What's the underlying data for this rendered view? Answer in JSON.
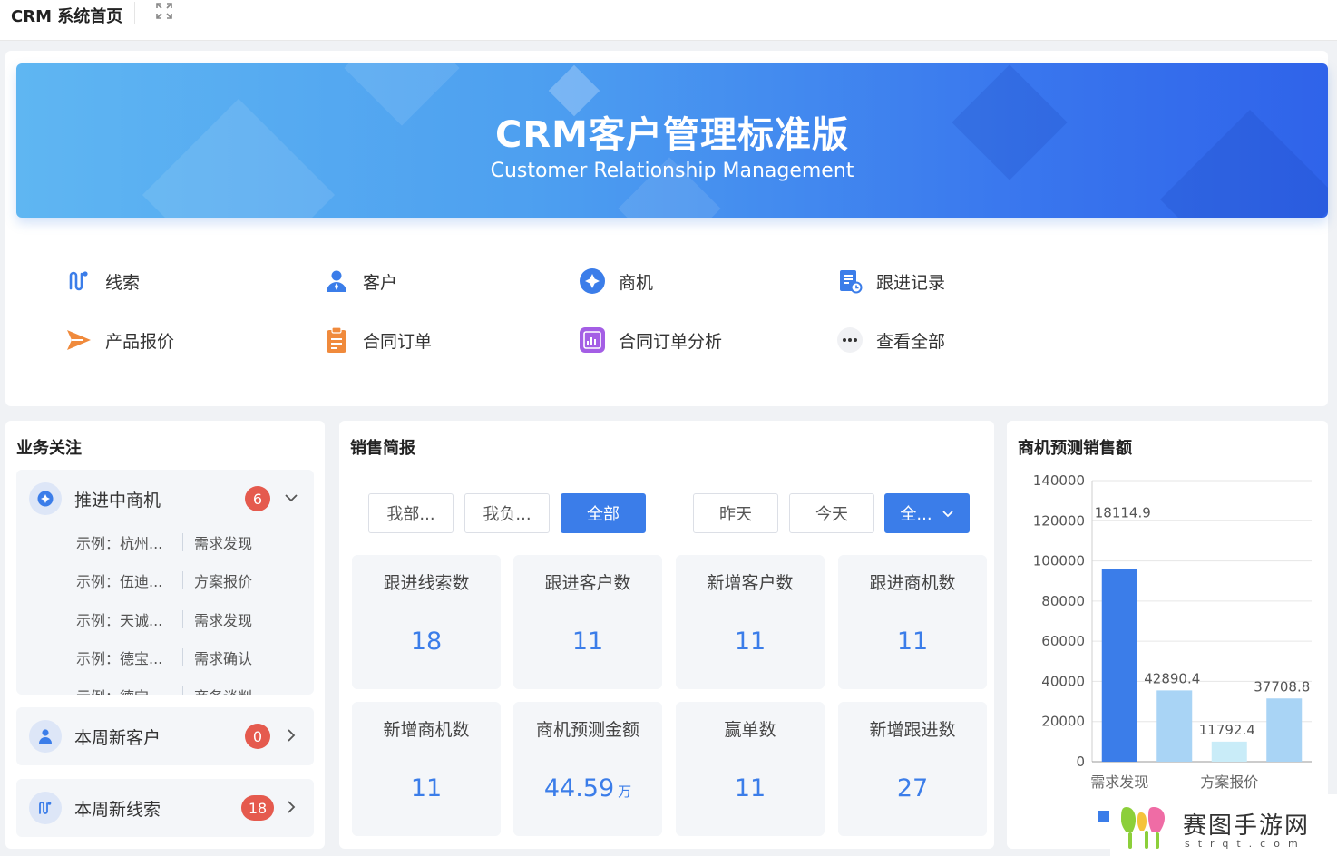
{
  "topbar": {
    "title": "CRM 系统首页"
  },
  "banner": {
    "title": "CRM客户管理标准版",
    "subtitle": "Customer Relationship Management"
  },
  "quick_links": [
    {
      "label": "线索",
      "icon": "leads-icon",
      "color": "#3b7de9"
    },
    {
      "label": "客户",
      "icon": "customer-icon",
      "color": "#3b7de9"
    },
    {
      "label": "商机",
      "icon": "opportunity-icon",
      "color": "#3b7de9"
    },
    {
      "label": "跟进记录",
      "icon": "followup-record-icon",
      "color": "#3b7de9"
    },
    {
      "label": "产品报价",
      "icon": "quote-arrow-icon",
      "color": "#f08a3c"
    },
    {
      "label": "合同订单",
      "icon": "contract-icon",
      "color": "#f08a3c"
    },
    {
      "label": "合同订单分析",
      "icon": "analysis-chart-icon",
      "color": "#a45ee5"
    },
    {
      "label": "查看全部",
      "icon": "more-dots-icon",
      "color": "#333333"
    }
  ],
  "business_focus": {
    "title": "业务关注",
    "groups": [
      {
        "label": "推进中商机",
        "count": "6",
        "expanded": true,
        "rows": [
          {
            "name": "示例：杭州...",
            "stage": "需求发现"
          },
          {
            "name": "示例：伍迪...",
            "stage": "方案报价"
          },
          {
            "name": "示例：天诚...",
            "stage": "需求发现"
          },
          {
            "name": "示例：德宝...",
            "stage": "需求确认"
          },
          {
            "name": "示例：德宝...",
            "stage": "商务谈判"
          }
        ]
      },
      {
        "label": "本周新客户",
        "count": "0",
        "expanded": false
      },
      {
        "label": "本周新线索",
        "count": "18",
        "expanded": false
      }
    ]
  },
  "sales_report": {
    "title": "销售简报",
    "scope_buttons": [
      "我部...",
      "我负...",
      "全部"
    ],
    "scope_active": "全部",
    "time_buttons": [
      "昨天",
      "今天"
    ],
    "time_dropdown": "全...",
    "stats": [
      {
        "label": "跟进线索数",
        "value": "18",
        "unit": ""
      },
      {
        "label": "跟进客户数",
        "value": "11",
        "unit": ""
      },
      {
        "label": "新增客户数",
        "value": "11",
        "unit": ""
      },
      {
        "label": "跟进商机数",
        "value": "11",
        "unit": ""
      },
      {
        "label": "新增商机数",
        "value": "11",
        "unit": ""
      },
      {
        "label": "商机预测金额",
        "value": "44.59",
        "unit": "万"
      },
      {
        "label": "赢单数",
        "value": "11",
        "unit": ""
      },
      {
        "label": "新增跟进数",
        "value": "27",
        "unit": ""
      }
    ]
  },
  "forecast": {
    "title": "商机预测销售额"
  },
  "chart_data": {
    "type": "bar",
    "title": "商机预测销售额",
    "xlabel": "",
    "ylabel": "",
    "ylim": [
      0,
      140000
    ],
    "yticks": [
      "0",
      "20000",
      "40000",
      "60000",
      "80000",
      "100000",
      "120000",
      "140000"
    ],
    "tick_labels": [
      "需求发现",
      "方案报价"
    ],
    "categories": [
      "需求发现",
      "",
      "方案报价",
      ""
    ],
    "values": [
      96000,
      35500,
      10000,
      31500
    ],
    "data_labels": [
      "18114.9",
      "42890.4",
      "11792.4",
      "37708.8"
    ],
    "colors": [
      "#3b7de9",
      "#a9d4f5",
      "#c9ecf8",
      "#a9d4f5"
    ],
    "legend_color": "#3b7de9",
    "grid": true
  },
  "watermark": {
    "text": "赛图手游网",
    "sub": "strqt.com"
  }
}
